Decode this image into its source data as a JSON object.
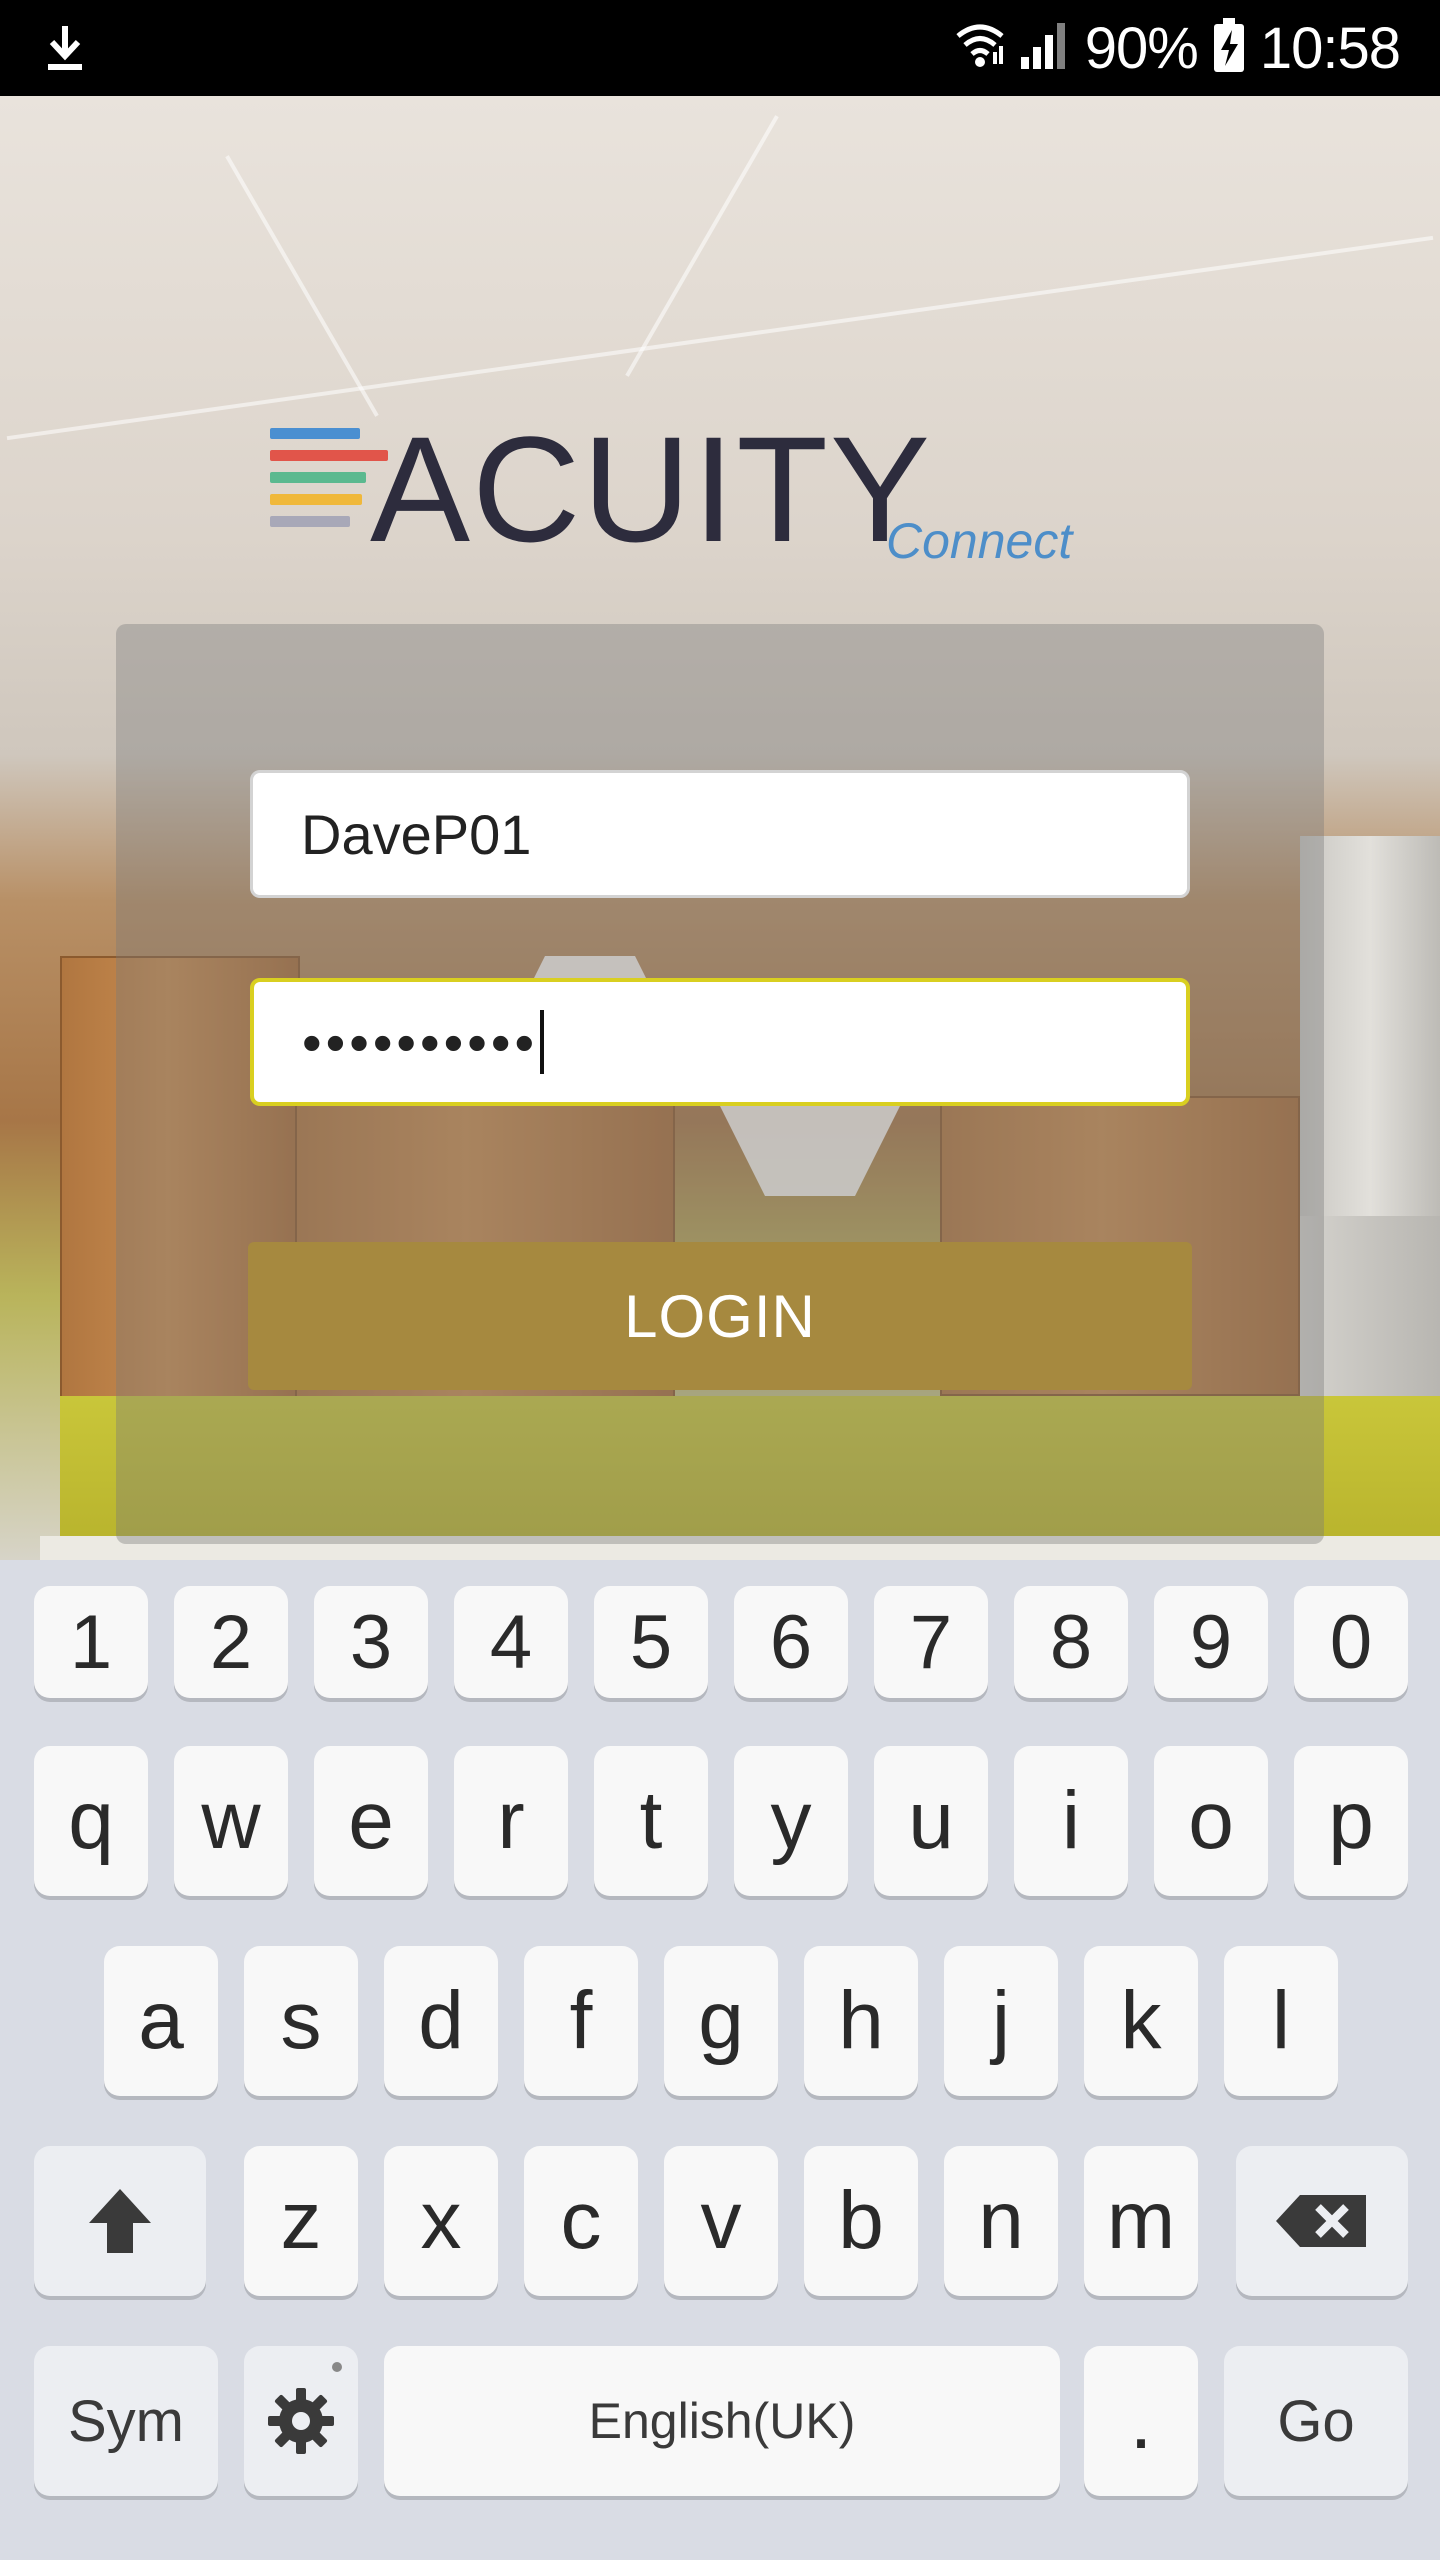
{
  "status_bar": {
    "battery_percent": "90%",
    "time": "10:58",
    "icons": [
      "download-icon",
      "wifi-icon",
      "signal-icon",
      "battery-charging-icon"
    ]
  },
  "logo": {
    "name": "ACUITY",
    "subtitle": "Connect",
    "stripe_colors": [
      "#4a8fd1",
      "#e1554a",
      "#5bb98f",
      "#f0b83a",
      "#a8a8b8"
    ]
  },
  "login": {
    "username_value": "DaveP01",
    "password_mask": "••••••••••",
    "login_label": "LOGIN",
    "accent_color": "#a6893f",
    "focus_border_color": "#d9cf20"
  },
  "keyboard": {
    "numbers": [
      "1",
      "2",
      "3",
      "4",
      "5",
      "6",
      "7",
      "8",
      "9",
      "0"
    ],
    "row1": [
      "q",
      "w",
      "e",
      "r",
      "t",
      "y",
      "u",
      "i",
      "o",
      "p"
    ],
    "row2": [
      "a",
      "s",
      "d",
      "f",
      "g",
      "h",
      "j",
      "k",
      "l"
    ],
    "row3": [
      "z",
      "x",
      "c",
      "v",
      "b",
      "n",
      "m"
    ],
    "sym_label": "Sym",
    "space_label": "English(UK)",
    "period_label": ".",
    "go_label": "Go"
  }
}
